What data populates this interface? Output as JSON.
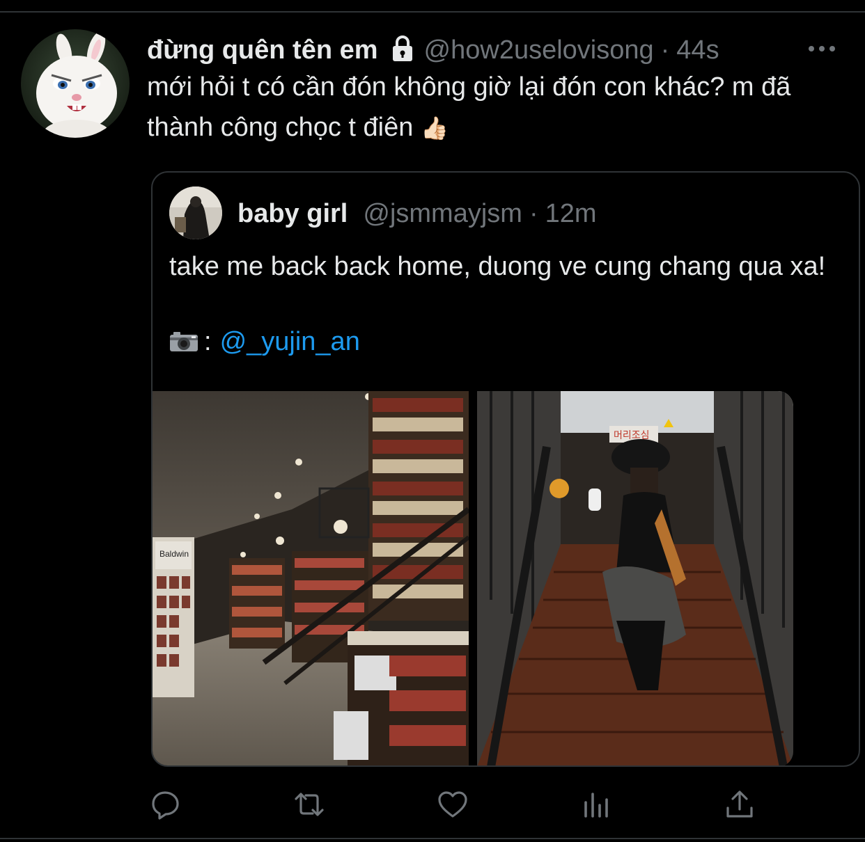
{
  "tweet": {
    "display_name": "đừng quên tên em",
    "handle": "@how2uselovisong",
    "separator": "·",
    "time": "44s",
    "text": "mới hỏi t có cần đón không giờ lại đón con khác? m đã thành công chọc t điên",
    "emoji": "👍🏻",
    "avatar_icon": "rabbit-avatar",
    "protected_icon": "lock-icon",
    "more_icon": "more-dots-icon"
  },
  "quote": {
    "display_name": "baby girl",
    "handle": "@jsmmayjsm",
    "separator": "·",
    "time": "12m",
    "text": "take me back back home, duong ve cung chang qua xa!",
    "credit_colon": ":",
    "credit_mention": "@_yujin_an",
    "credit_icon": "camera-icon",
    "photos": [
      {
        "name": "bookstore-photo"
      },
      {
        "name": "staircase-photo",
        "sign_text": "머리조심"
      }
    ]
  },
  "actions": [
    {
      "name": "reply-icon"
    },
    {
      "name": "retweet-icon"
    },
    {
      "name": "like-icon"
    },
    {
      "name": "analytics-icon"
    },
    {
      "name": "share-icon"
    }
  ],
  "colors": {
    "background": "#000000",
    "text_primary": "#e7e9ea",
    "text_secondary": "#71767b",
    "link": "#1d9bf0",
    "border": "#2f3336"
  }
}
